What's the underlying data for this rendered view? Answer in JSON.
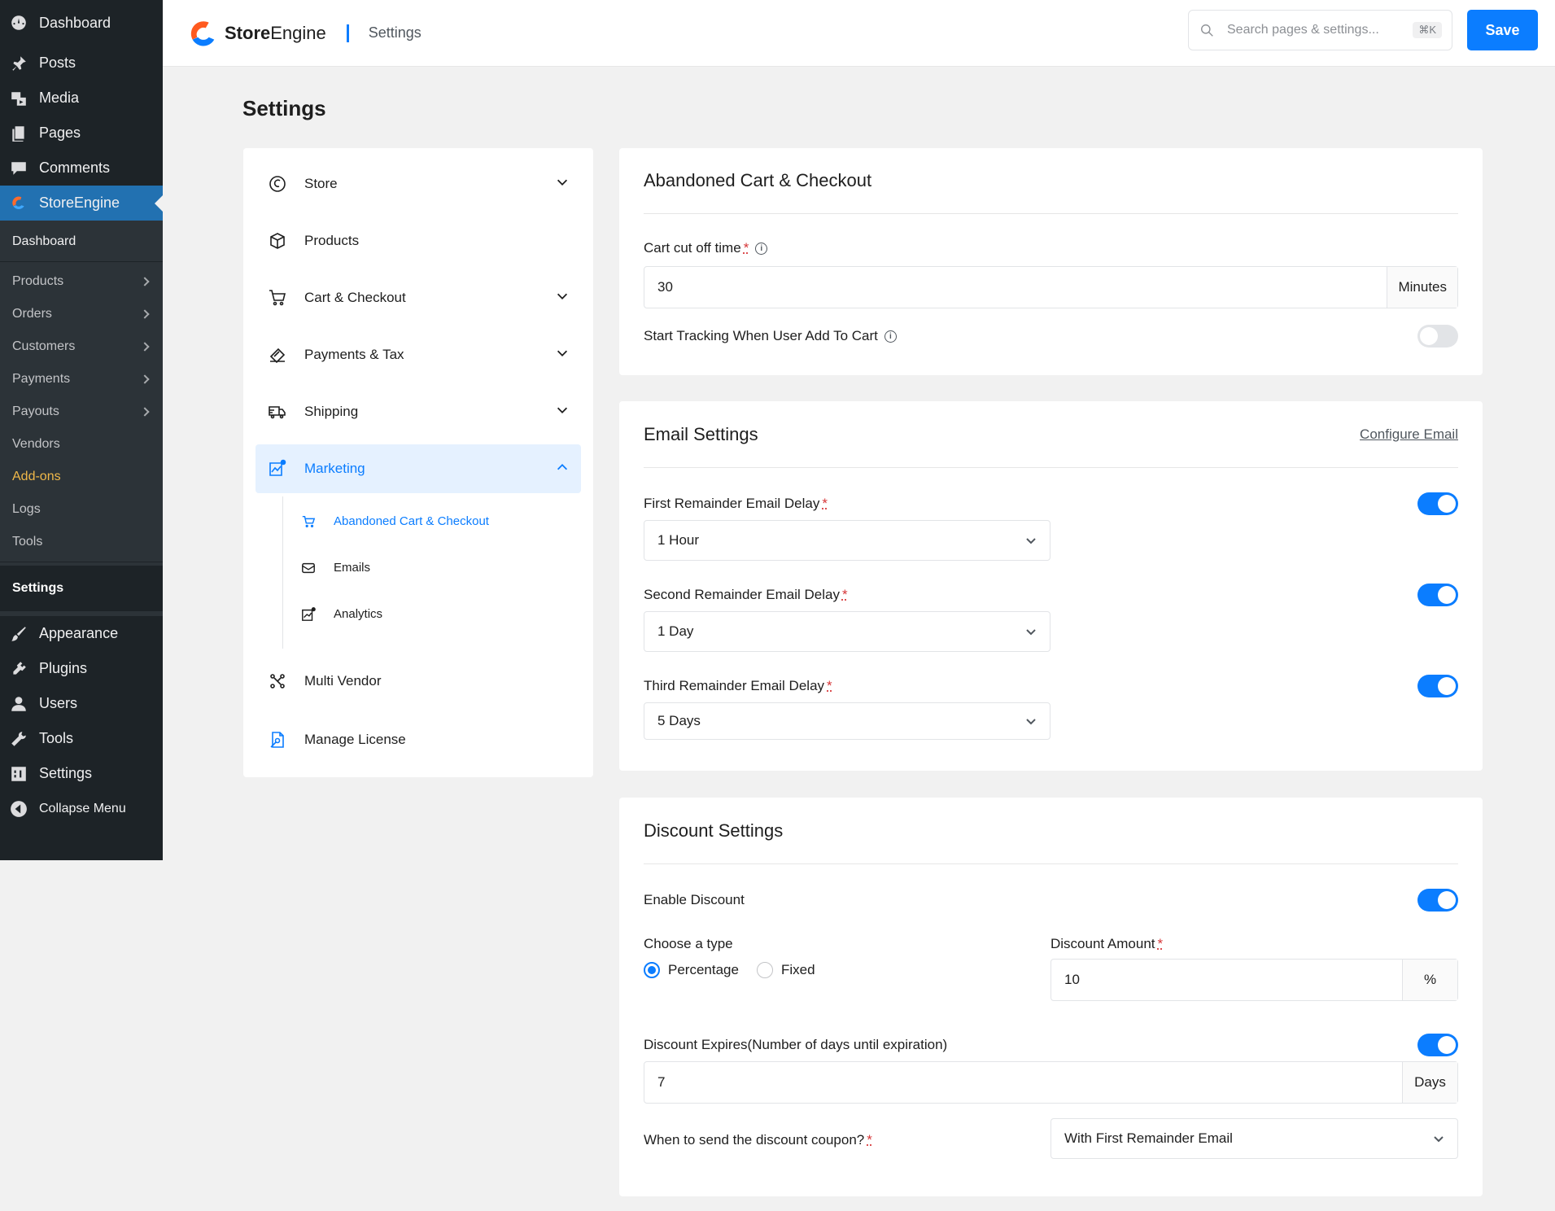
{
  "wp_menu": {
    "dashboard": "Dashboard",
    "posts": "Posts",
    "media": "Media",
    "pages": "Pages",
    "comments": "Comments",
    "storeengine": "StoreEngine",
    "sub": {
      "dashboard": "Dashboard",
      "products": "Products",
      "orders": "Orders",
      "customers": "Customers",
      "payments": "Payments",
      "payouts": "Payouts",
      "vendors": "Vendors",
      "addons": "Add-ons",
      "logs": "Logs",
      "tools": "Tools",
      "settings": "Settings"
    },
    "appearance": "Appearance",
    "plugins": "Plugins",
    "users": "Users",
    "tools": "Tools",
    "settings": "Settings",
    "collapse": "Collapse Menu"
  },
  "topbar": {
    "brand_bold": "Store",
    "brand_rest": "Engine",
    "breadcrumb": "Settings",
    "search_placeholder": "Search pages & settings...",
    "shortcut": "⌘K",
    "save_label": "Save"
  },
  "page_title": "Settings",
  "settings_nav": {
    "store": "Store",
    "products": "Products",
    "cart_checkout": "Cart & Checkout",
    "payments_tax": "Payments & Tax",
    "shipping": "Shipping",
    "marketing": "Marketing",
    "marketing_sub": {
      "abandoned": "Abandoned Cart & Checkout",
      "emails": "Emails",
      "analytics": "Analytics"
    },
    "multi_vendor": "Multi Vendor",
    "manage_license": "Manage License"
  },
  "abandoned": {
    "title": "Abandoned Cart & Checkout",
    "cutoff_label": "Cart cut off time",
    "cutoff_value": "30",
    "cutoff_unit": "Minutes",
    "tracking_label": "Start Tracking When User Add To Cart",
    "tracking_enabled": false
  },
  "email": {
    "title": "Email Settings",
    "configure_link": "Configure Email",
    "first_label": "First Remainder Email Delay",
    "first_value": "1 Hour",
    "second_label": "Second Remainder Email Delay",
    "second_value": "1 Day",
    "third_label": "Third Remainder Email Delay",
    "third_value": "5 Days"
  },
  "discount": {
    "title": "Discount Settings",
    "enable_label": "Enable Discount",
    "type_label": "Choose a type",
    "type_percentage": "Percentage",
    "type_fixed": "Fixed",
    "amount_label": "Discount Amount",
    "amount_value": "10",
    "amount_unit": "%",
    "expires_label": "Discount Expires(Number of days until expiration)",
    "expires_value": "7",
    "expires_unit": "Days",
    "send_label": "When to send the discount coupon?",
    "send_value": "With First Remainder Email"
  },
  "colors": {
    "accent": "#0b7dff",
    "wp_sidebar": "#1d2327",
    "required": "#d63638"
  }
}
